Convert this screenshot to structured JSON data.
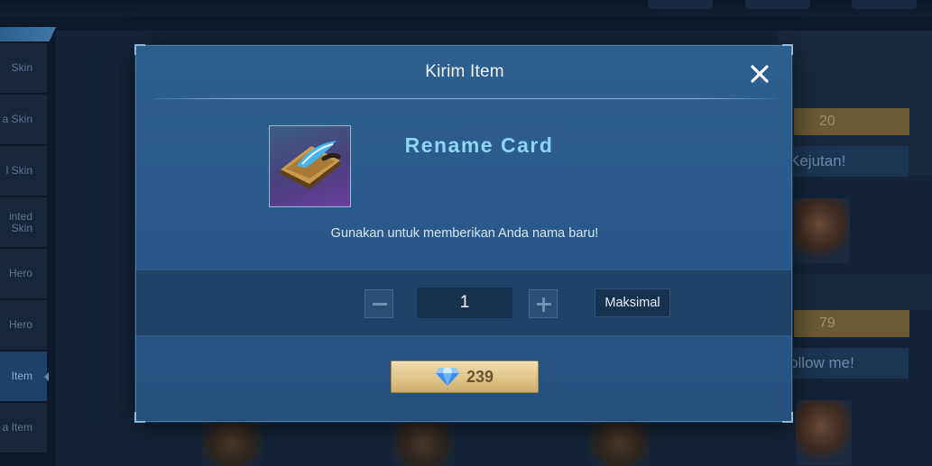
{
  "background": {
    "sidebar": {
      "items": [
        {
          "label": "Skin"
        },
        {
          "label": "a Skin"
        },
        {
          "label": "l Skin"
        },
        {
          "label": "inted Skin"
        },
        {
          "label": "Hero"
        },
        {
          "label": "Hero"
        },
        {
          "label": "Item",
          "active": true
        },
        {
          "label": "a Item"
        }
      ]
    },
    "cards": {
      "price_top": "20",
      "bubble_top": "Kejutan!",
      "price_bottom": "79",
      "bubble_bottom": "ollow me!"
    }
  },
  "modal": {
    "title": "Kirim Item",
    "item": {
      "name": "Rename Card",
      "description": "Gunakan untuk memberikan Anda nama baru!",
      "icon": "rename-card-icon"
    },
    "quantity": {
      "value": "1",
      "max_label": "Maksimal"
    },
    "purchase": {
      "price": "239",
      "currency_icon": "diamond-icon"
    }
  },
  "colors": {
    "modal_bg": "#2d5f8e",
    "item_name": "#8ed5f5",
    "button_gold": "#e4c98f",
    "diamond": "#5aa8ff"
  }
}
